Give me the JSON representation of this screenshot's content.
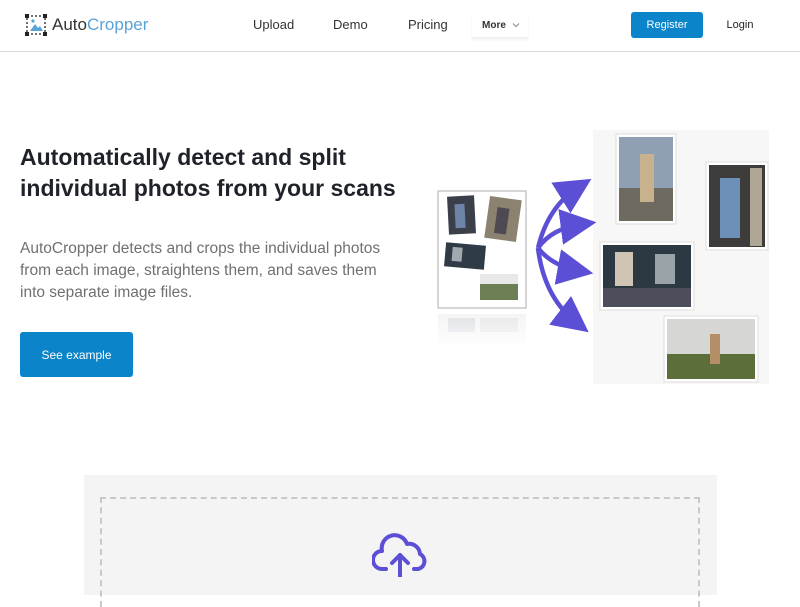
{
  "brand": {
    "name_part1": "Auto",
    "name_part2": "Cropper"
  },
  "nav": {
    "upload": "Upload",
    "demo": "Demo",
    "pricing": "Pricing",
    "more": "More"
  },
  "auth": {
    "register": "Register",
    "login": "Login"
  },
  "hero": {
    "title": "Automatically detect and split individual photos from your scans",
    "description": "AutoCropper detects and crops the individual photos from each image, straightens them, and saves them into separate image files.",
    "cta": "See example"
  },
  "colors": {
    "primary": "#0b84c9",
    "brand_accent": "#5aa3d8",
    "arrow": "#5b4fd6",
    "panel": "#f4f4f5"
  },
  "icons": {
    "logo": "crop-frame-icon",
    "more": "chevron-down-icon",
    "upload": "cloud-upload-icon",
    "arrows": "curved-arrow-icon"
  }
}
